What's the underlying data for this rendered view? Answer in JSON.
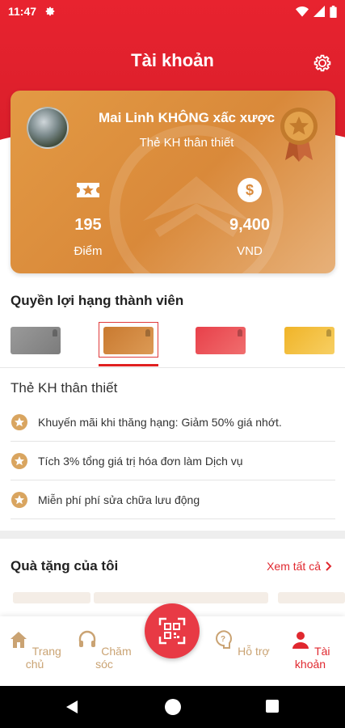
{
  "status_bar": {
    "time": "11:47"
  },
  "header": {
    "title": "Tài khoản"
  },
  "card": {
    "user_name": "Mai Linh KHÔNG xấc xược",
    "tier": "Thẻ KH thân thiết",
    "points_value": "195",
    "points_label": "Điểm",
    "money_value": "9,400",
    "money_label": "VND"
  },
  "membership": {
    "title": "Quyền lợi hạng thành viên",
    "tiers": [
      "silver",
      "gold",
      "red",
      "yellow"
    ],
    "selected_tier": "gold",
    "benefit_title": "Thẻ KH thân thiết",
    "benefits": [
      "Khuyến mãi khi thăng hạng: Giảm 50% giá nhớt.",
      "Tích 3% tổng giá trị hóa đơn làm Dịch vụ",
      "Miễn phí phí sửa chữa lưu động"
    ]
  },
  "gifts": {
    "title": "Quà tặng của tôi",
    "see_all": "Xem tất cả"
  },
  "bottom_nav": {
    "items": [
      {
        "label": "Trang chủ",
        "icon": "home-icon"
      },
      {
        "label": "Chăm sóc",
        "icon": "headset-icon"
      },
      {
        "label": "",
        "icon": "qr-scan-icon"
      },
      {
        "label": "Hỗ trợ",
        "icon": "help-icon"
      },
      {
        "label": "Tài khoản",
        "icon": "user-icon"
      }
    ],
    "active": "Tài khoản"
  },
  "colors": {
    "brand_red": "#e0282f",
    "card_orange": "#d9893a",
    "nav_inactive": "#caa373"
  }
}
